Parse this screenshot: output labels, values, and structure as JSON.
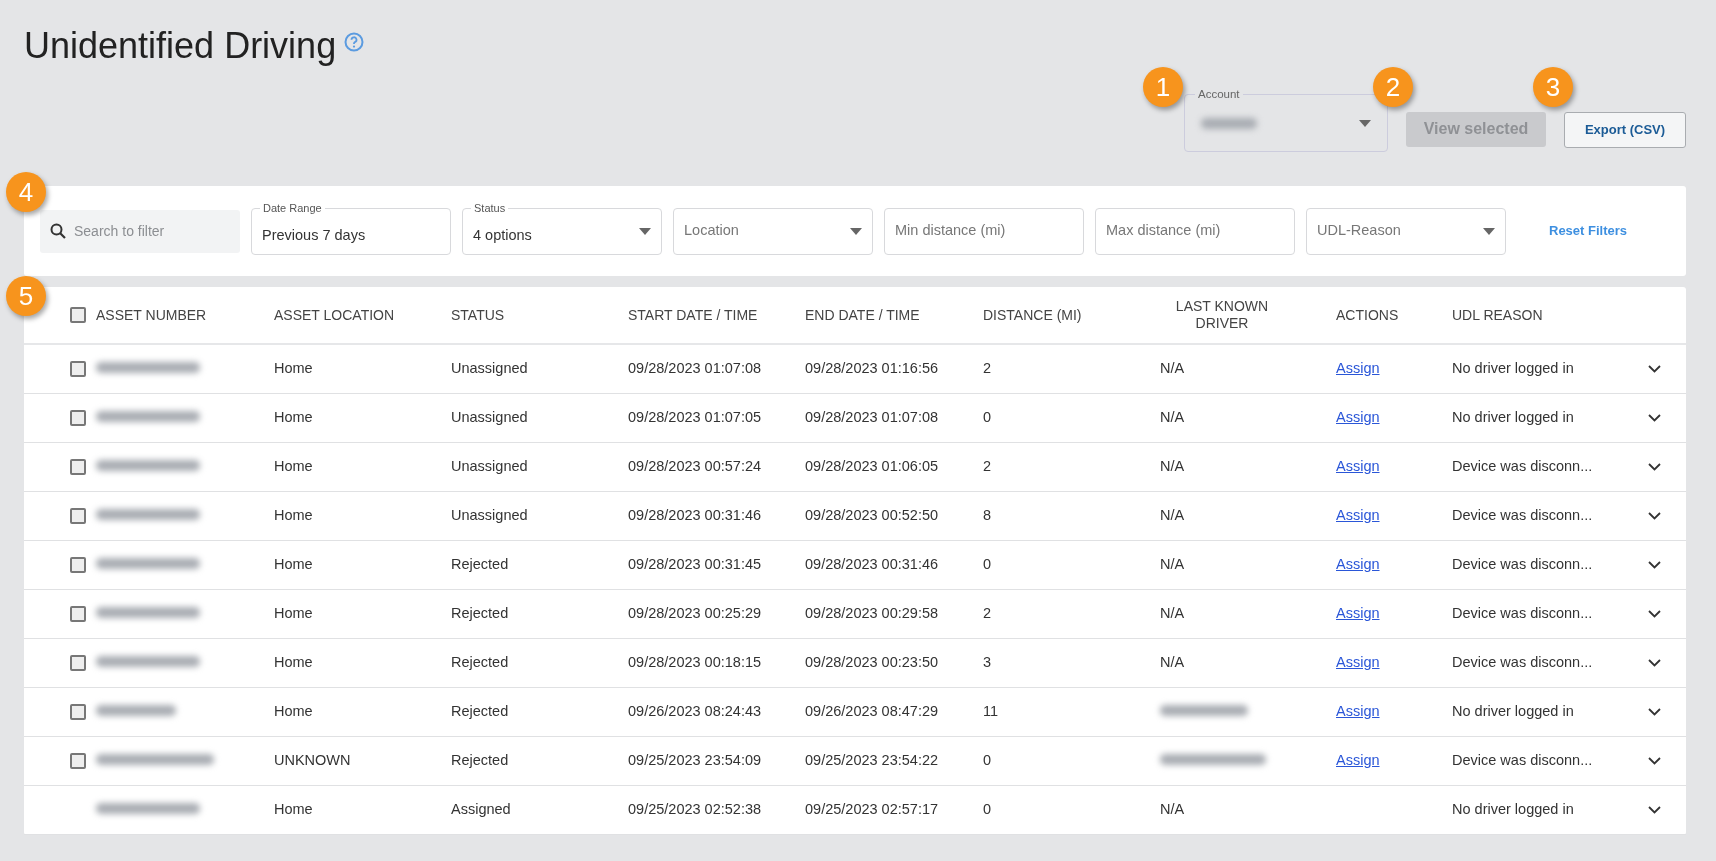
{
  "title": "Unidentified Driving",
  "account": {
    "label": "Account",
    "value_redacted": true
  },
  "buttons": [
    {
      "label": "View selected",
      "disabled": true
    },
    {
      "label": "Export (CSV)",
      "disabled": false
    }
  ],
  "callouts": [
    "1",
    "2",
    "3",
    "4",
    "5"
  ],
  "filters": {
    "search": {
      "placeholder": "Search to filter"
    },
    "fields": [
      {
        "kind": "text",
        "label": "Date Range",
        "value": "Previous 7 days"
      },
      {
        "kind": "select",
        "label": "Status",
        "value": "4 options"
      },
      {
        "kind": "select",
        "placeholder": "Location"
      },
      {
        "kind": "text",
        "placeholder": "Min distance (mi)"
      },
      {
        "kind": "text",
        "placeholder": "Max distance (mi)"
      },
      {
        "kind": "select",
        "placeholder": "UDL-Reason"
      }
    ],
    "reset": "Reset Filters"
  },
  "table": {
    "select_all_checked": false,
    "columns": [
      "ASSET NUMBER",
      "ASSET LOCATION",
      "STATUS",
      "START DATE / TIME",
      "END DATE / TIME",
      "DISTANCE (MI)",
      "LAST KNOWN DRIVER",
      "ACTIONS",
      "UDL REASON"
    ],
    "rows": [
      {
        "selectable": true,
        "checked": false,
        "asset": {
          "kind": "redacted"
        },
        "location": "Home",
        "status": "Unassigned",
        "start": "09/28/2023 01:07:08",
        "end": "09/28/2023 01:16:56",
        "distance": "2",
        "driver": {
          "kind": "text",
          "text": "N/A"
        },
        "action": "Assign",
        "reason": "No driver logged in"
      },
      {
        "selectable": true,
        "checked": false,
        "asset": {
          "kind": "redacted"
        },
        "location": "Home",
        "status": "Unassigned",
        "start": "09/28/2023 01:07:05",
        "end": "09/28/2023 01:07:08",
        "distance": "0",
        "driver": {
          "kind": "text",
          "text": "N/A"
        },
        "action": "Assign",
        "reason": "No driver logged in"
      },
      {
        "selectable": true,
        "checked": false,
        "asset": {
          "kind": "redacted"
        },
        "location": "Home",
        "status": "Unassigned",
        "start": "09/28/2023 00:57:24",
        "end": "09/28/2023 01:06:05",
        "distance": "2",
        "driver": {
          "kind": "text",
          "text": "N/A"
        },
        "action": "Assign",
        "reason": "Device was disconn..."
      },
      {
        "selectable": true,
        "checked": false,
        "asset": {
          "kind": "redacted"
        },
        "location": "Home",
        "status": "Unassigned",
        "start": "09/28/2023 00:31:46",
        "end": "09/28/2023 00:52:50",
        "distance": "8",
        "driver": {
          "kind": "text",
          "text": "N/A"
        },
        "action": "Assign",
        "reason": "Device was disconn..."
      },
      {
        "selectable": true,
        "checked": false,
        "asset": {
          "kind": "redacted"
        },
        "location": "Home",
        "status": "Rejected",
        "start": "09/28/2023 00:31:45",
        "end": "09/28/2023 00:31:46",
        "distance": "0",
        "driver": {
          "kind": "text",
          "text": "N/A"
        },
        "action": "Assign",
        "reason": "Device was disconn..."
      },
      {
        "selectable": true,
        "checked": false,
        "asset": {
          "kind": "redacted"
        },
        "location": "Home",
        "status": "Rejected",
        "start": "09/28/2023 00:25:29",
        "end": "09/28/2023 00:29:58",
        "distance": "2",
        "driver": {
          "kind": "text",
          "text": "N/A"
        },
        "action": "Assign",
        "reason": "Device was disconn..."
      },
      {
        "selectable": true,
        "checked": false,
        "asset": {
          "kind": "redacted"
        },
        "location": "Home",
        "status": "Rejected",
        "start": "09/28/2023 00:18:15",
        "end": "09/28/2023 00:23:50",
        "distance": "3",
        "driver": {
          "kind": "text",
          "text": "N/A"
        },
        "action": "Assign",
        "reason": "Device was disconn..."
      },
      {
        "selectable": true,
        "checked": false,
        "asset": {
          "kind": "redacted"
        },
        "location": "Home",
        "status": "Rejected",
        "start": "09/26/2023 08:24:43",
        "end": "09/26/2023 08:47:29",
        "distance": "11",
        "driver": {
          "kind": "redacted"
        },
        "action": "Assign",
        "reason": "No driver logged in"
      },
      {
        "selectable": true,
        "checked": false,
        "asset": {
          "kind": "redacted"
        },
        "location": "UNKNOWN",
        "status": "Rejected",
        "start": "09/25/2023 23:54:09",
        "end": "09/25/2023 23:54:22",
        "distance": "0",
        "driver": {
          "kind": "redacted"
        },
        "action": "Assign",
        "reason": "Device was disconn..."
      },
      {
        "selectable": false,
        "asset": {
          "kind": "redacted"
        },
        "location": "Home",
        "status": "Assigned",
        "start": "09/25/2023 02:52:38",
        "end": "09/25/2023 02:57:17",
        "distance": "0",
        "driver": {
          "kind": "text",
          "text": "N/A"
        },
        "reason": "No driver logged in"
      }
    ]
  }
}
